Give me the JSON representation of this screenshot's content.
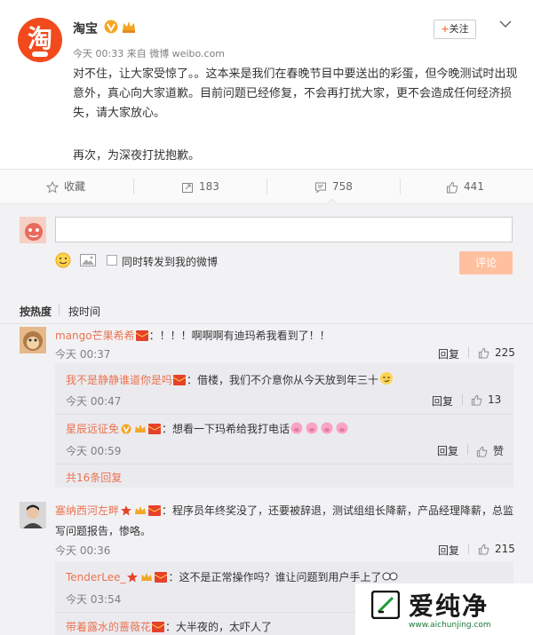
{
  "post": {
    "author": "淘宝",
    "meta": "今天 00:33 来自 微博 weibo.com",
    "follow_label": "关注",
    "text": "对不住，让大家受惊了。。这本来是我们在春晚节目中要送出的彩蛋，但今晚测试时出现意外，真心向大家道歉。目前问题已经修复，不会再打扰大家，更不会造成任何经济损失，请大家放心。",
    "text2": "再次，为深夜打扰抱歉。",
    "colors": {
      "brand": "#f24a1c",
      "accent": "#eb7350"
    }
  },
  "actions": {
    "favorite": "收藏",
    "repost": "183",
    "comment": "758",
    "like": "441"
  },
  "reply": {
    "repost_label": "同时转发到我的微博",
    "submit_label": "评论"
  },
  "sort": {
    "hot": "按热度",
    "time": "按时间"
  },
  "comments": [
    {
      "name": "mango芒果希希",
      "text": "：！！！啊啊啊有迪玛希我看到了！！",
      "time": "今天 00:37",
      "reply": "回复",
      "likes": "225",
      "sub": [
        {
          "name": "我不是静静谁道你是吗",
          "text": "：借楼，我们不介意你从今天放到年三十",
          "time": "今天 00:47",
          "reply": "回复",
          "likes": "13"
        },
        {
          "name": "星辰远征免",
          "text": "：想看一下玛希给我打电话",
          "time": "今天 00:59",
          "reply": "回复",
          "likes": "赞"
        }
      ],
      "more": "共16条回复"
    },
    {
      "name": "塞纳西河左畔",
      "text": "：程序员年终奖没了，还要被辞退，测试组组长降薪，产品经理降薪，总监",
      "text2": "写问题报告，惨咯。",
      "time": "今天 00:36",
      "reply": "回复",
      "likes": "215",
      "sub": [
        {
          "name": "TenderLee_",
          "text": "：这不是正常操作吗？谁让问题到用户手上了",
          "time": "今天 03:54"
        },
        {
          "name": "带着露水的蔷薇花",
          "text": "：大半夜的，太吓人了"
        }
      ]
    }
  ],
  "watermark": {
    "title": "爱纯净",
    "url": "www.aichunjing.com"
  }
}
